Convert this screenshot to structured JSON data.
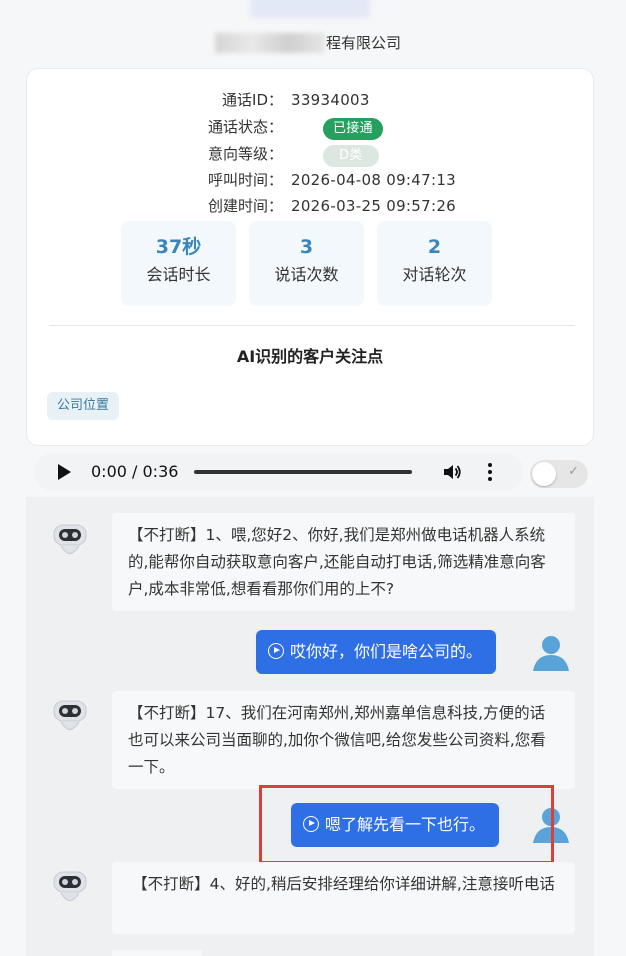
{
  "header": {
    "company_suffix": "程有限公司"
  },
  "call_info": {
    "call_id_label": "通话ID：",
    "call_id": "33934003",
    "status_label": "通话状态：",
    "status": "已接通",
    "intent_label": "意向等级：",
    "intent": "D类",
    "call_time_label": "呼叫时间：",
    "call_time": "2026-04-08 09:47:13",
    "created_label": "创建时间：",
    "created_time": "2026-03-25 09:57:26",
    "colors": {
      "status_tag": "#25a05e",
      "stat_value": "#3a86b8"
    }
  },
  "stats": [
    {
      "value": "37秒",
      "label": "会话时长"
    },
    {
      "value": "3",
      "label": "说话次数"
    },
    {
      "value": "2",
      "label": "对话轮次"
    }
  ],
  "focus": {
    "title": "AI识别的客户关注点",
    "tags": [
      "公司位置"
    ]
  },
  "audio": {
    "time": "0:00 / 0:36",
    "icons": [
      "play-icon",
      "volume-icon",
      "more-vert-icon"
    ]
  },
  "conversation": [
    {
      "role": "ai",
      "text": "【不打断】1、喂,您好2、你好,我们是郑州做电话机器人系统的,能帮你自动获取意向客户,还能自动打电话,筛选精准意向客户,成本非常低,想看看那你们用的上不?"
    },
    {
      "role": "user",
      "text": "哎你好，你们是啥公司的。"
    },
    {
      "role": "ai",
      "text": "【不打断】17、我们在河南郑州,郑州嘉单信息科技,方便的话也可以来公司当面聊的,加你个微信吧,给您发些公司资料,您看一下。"
    },
    {
      "role": "user",
      "text": "嗯了解先看一下也行。"
    },
    {
      "role": "ai",
      "text": "【不打断】4、好的,稍后安排经理给你详细讲解,注意接听电话"
    }
  ]
}
